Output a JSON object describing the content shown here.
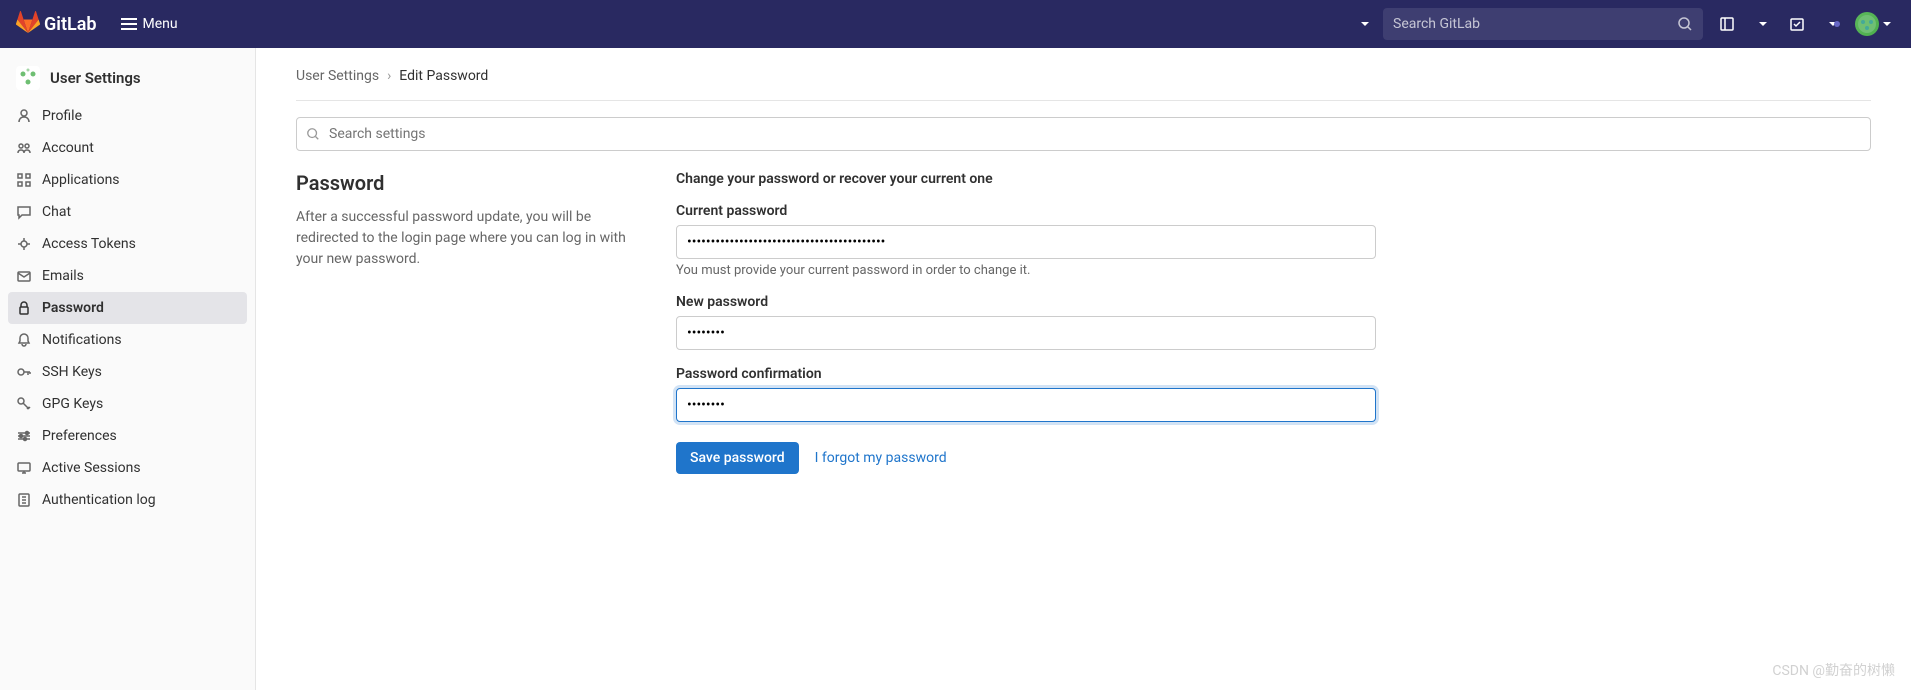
{
  "header": {
    "brand": "GitLab",
    "menu_label": "Menu",
    "search_placeholder": "Search GitLab"
  },
  "sidebar": {
    "title": "User Settings",
    "items": [
      {
        "label": "Profile",
        "icon": "user"
      },
      {
        "label": "Account",
        "icon": "account"
      },
      {
        "label": "Applications",
        "icon": "apps"
      },
      {
        "label": "Chat",
        "icon": "chat"
      },
      {
        "label": "Access Tokens",
        "icon": "token"
      },
      {
        "label": "Emails",
        "icon": "mail"
      },
      {
        "label": "Password",
        "icon": "lock",
        "active": true
      },
      {
        "label": "Notifications",
        "icon": "bell"
      },
      {
        "label": "SSH Keys",
        "icon": "key"
      },
      {
        "label": "GPG Keys",
        "icon": "gpgkey"
      },
      {
        "label": "Preferences",
        "icon": "prefs"
      },
      {
        "label": "Active Sessions",
        "icon": "sessions"
      },
      {
        "label": "Authentication log",
        "icon": "authlog"
      }
    ]
  },
  "breadcrumb": {
    "parent": "User Settings",
    "current": "Edit Password"
  },
  "search_settings_placeholder": "Search settings",
  "password_section": {
    "title": "Password",
    "description": "After a successful password update, you will be redirected to the login page where you can log in with your new password.",
    "form_heading": "Change your password or recover your current one",
    "current_password_label": "Current password",
    "current_password_value": "••••••••••••••••••••••••••••••••••••••••••",
    "current_password_help": "You must provide your current password in order to change it.",
    "new_password_label": "New password",
    "new_password_value": "••••••••",
    "confirm_password_label": "Password confirmation",
    "confirm_password_value": "••••••••",
    "save_button": "Save password",
    "forgot_link": "I forgot my password"
  },
  "watermark": "CSDN @勤奋的树懒"
}
